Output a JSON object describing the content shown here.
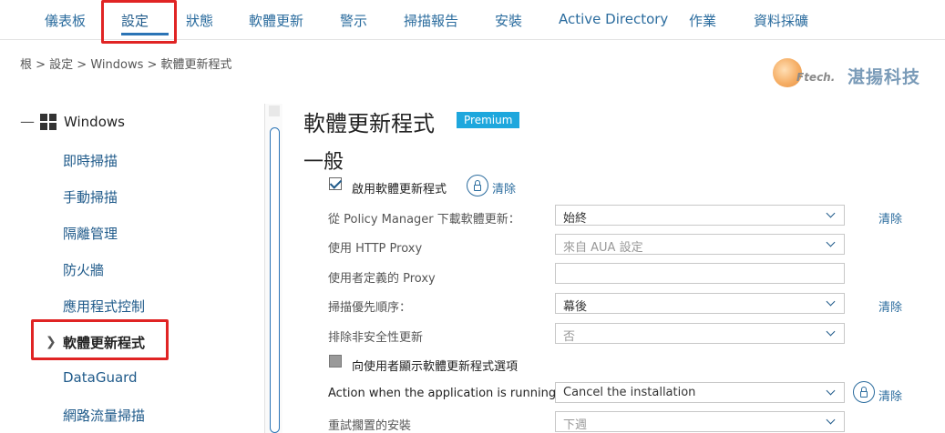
{
  "nav": {
    "items": [
      "儀表板",
      "設定",
      "狀態",
      "軟體更新",
      "警示",
      "掃描報告",
      "安裝",
      "Active Directory",
      "作業",
      "資料採礦"
    ]
  },
  "breadcrumb": "根 > 設定 > Windows > 軟體更新程式",
  "logo": {
    "tech": "Ftech.",
    "name": "湛揚科技"
  },
  "sidebar": {
    "root_label": "Windows",
    "items": [
      "即時掃描",
      "手動掃描",
      "隔離管理",
      "防火牆",
      "應用程式控制",
      "軟體更新程式",
      "DataGuard",
      "網路流量掃描"
    ]
  },
  "main": {
    "title": "軟體更新程式",
    "badge": "Premium",
    "section": "一般",
    "enable_label": "啟用軟體更新程式",
    "clear": "清除",
    "rows": [
      {
        "label": "從 Policy Manager 下載軟體更新：",
        "value": "始終"
      },
      {
        "label": "使用 HTTP Proxy",
        "value": "來自 AUA 設定"
      },
      {
        "label": "使用者定義的 Proxy",
        "value": ""
      },
      {
        "label": "掃描優先順序：",
        "value": "幕後"
      },
      {
        "label": "排除非安全性更新",
        "value": "否"
      },
      {
        "label": "向使用者顯示軟體更新程式選項",
        "value": ""
      },
      {
        "label": "Action when the application is running:",
        "value": "Cancel the installation"
      },
      {
        "label": "重試擱置的安裝",
        "value": "下週"
      }
    ]
  },
  "colors": {
    "accent": "#2b74b6",
    "link": "#2b6c9e",
    "badge": "#1ea7dd",
    "highlight_box": "#e02424"
  }
}
